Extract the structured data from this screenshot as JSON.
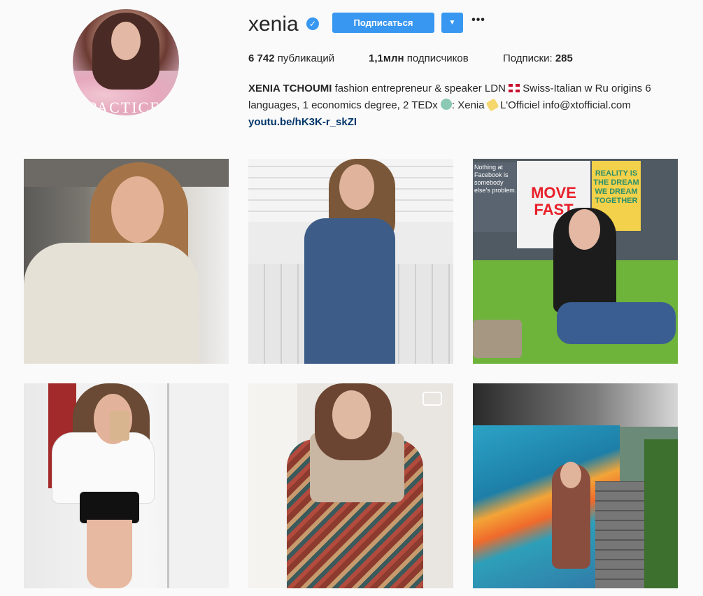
{
  "profile": {
    "avatar_text": "PACTICE",
    "username": "xenia",
    "verified_badge": "✓",
    "follow_label": "Подписаться",
    "dropdown_icon": "▼",
    "more_icon": "•••",
    "stats": {
      "posts_count": "6 742",
      "posts_label": "публикаций",
      "followers_count": "1,1млн",
      "followers_label": "подписчиков",
      "following_label": "Подписки:",
      "following_count": "285"
    },
    "bio": {
      "name": "XENIA TCHOUMI",
      "text_1": "fashion entrepreneur & speaker LDN",
      "text_2": "Swiss-Italian w Ru origins 6 languages, 1 economics degree, 2 TEDx",
      "text_3": ": Xenia",
      "text_4": "L'Officiel info@xtofficial.com",
      "link": "youtu.be/hK3K-r_skZI"
    }
  },
  "grid": {
    "posts": [
      {
        "kind": "photo",
        "icon": ""
      },
      {
        "kind": "photo",
        "icon": ""
      },
      {
        "kind": "photo",
        "icon": "",
        "signs": [
          "Nothing at Facebook is somebody else's problem.",
          "MOVE FAST",
          "REALITY IS THE DREAM WE DREAM TOGETHER"
        ]
      },
      {
        "kind": "photo",
        "icon": ""
      },
      {
        "kind": "video",
        "icon": "video-camera-icon"
      },
      {
        "kind": "photo",
        "icon": ""
      }
    ]
  },
  "colors": {
    "accent": "#3897f0",
    "background": "#fafafa",
    "text": "#262626",
    "link": "#003569"
  }
}
